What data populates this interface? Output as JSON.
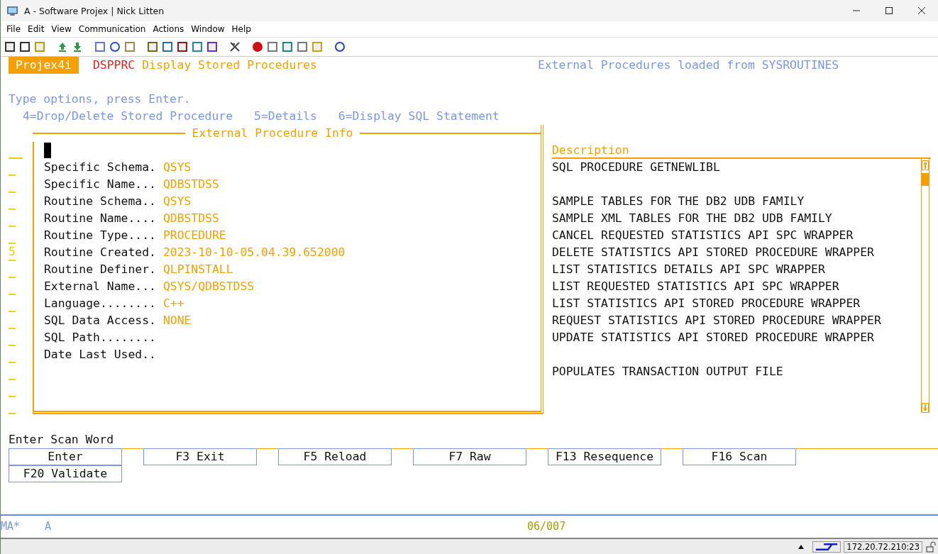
{
  "window": {
    "title": "A - Software Projex | Nick Litten"
  },
  "menu": [
    {
      "label": "File"
    },
    {
      "label": "Edit"
    },
    {
      "label": "View"
    },
    {
      "label": "Communication"
    },
    {
      "label": "Actions"
    },
    {
      "label": "Window"
    },
    {
      "label": "Help"
    }
  ],
  "header": {
    "product": "Projex4i",
    "command": "DSPPRC",
    "title": "Display Stored Procedures",
    "info": "External Procedures loaded from SYSROUTINES"
  },
  "instructions": "Type options, press Enter.",
  "options": [
    "4=Drop/Delete Stored Procedure",
    "5=Details",
    "6=Display SQL Statement"
  ],
  "option_fields": [
    {
      "kind": "position"
    },
    {
      "kind": "option"
    },
    {
      "kind": "option"
    },
    {
      "kind": "option"
    },
    {
      "kind": "option"
    },
    {
      "kind": "option"
    },
    {
      "kind": "option",
      "value": "5"
    },
    {
      "kind": "option"
    },
    {
      "kind": "option"
    },
    {
      "kind": "option"
    },
    {
      "kind": "option"
    },
    {
      "kind": "option"
    },
    {
      "kind": "option"
    },
    {
      "kind": "option"
    },
    {
      "kind": "option"
    },
    {
      "kind": "option"
    }
  ],
  "popup": {
    "title": "External Procedure Info",
    "fields": [
      {
        "label": "Specific Schema.",
        "value": "QSYS"
      },
      {
        "label": "Specific Name...",
        "value": "QDBSTDSS"
      },
      {
        "label": "Routine Schema..",
        "value": "QSYS"
      },
      {
        "label": "Routine Name....",
        "value": "QDBSTDSS"
      },
      {
        "label": "Routine Type....",
        "value": "PROCEDURE"
      },
      {
        "label": "Routine Created.",
        "value": "2023-10-10-05.04.39.652000"
      },
      {
        "label": "Routine Definer.",
        "value": "QLPINSTALL"
      },
      {
        "label": "External Name...",
        "value": "QSYS/QDBSTDSS"
      },
      {
        "label": "Language........",
        "value": "C++"
      },
      {
        "label": "SQL Data Access.",
        "value": "NONE"
      },
      {
        "label": "SQL Path........"
      },
      {
        "label": "Date Last Used.."
      }
    ]
  },
  "list": {
    "heading": "Description",
    "rows": [
      {
        "kind": "text",
        "description": "SQL PROCEDURE GETNEWLIBL"
      },
      {
        "kind": "blank"
      },
      {
        "kind": "text",
        "description": "SAMPLE TABLES FOR THE DB2 UDB FAMILY"
      },
      {
        "kind": "text",
        "description": "SAMPLE XML TABLES FOR THE DB2 UDB FAMILY"
      },
      {
        "kind": "text",
        "description": "CANCEL REQUESTED STATISTICS API SPC WRAPPER"
      },
      {
        "kind": "text",
        "description": "DELETE STATISTICS API STORED PROCEDURE WRAPPER"
      },
      {
        "kind": "text",
        "description": "LIST STATISTICS DETAILS API SPC WRAPPER"
      },
      {
        "kind": "text",
        "description": "LIST REQUESTED STATISTICS API SPC WRAPPER"
      },
      {
        "kind": "text",
        "description": "LIST STATISTICS API STORED PROCEDURE WRAPPER"
      },
      {
        "kind": "text",
        "description": "REQUEST STATISTICS API STORED PROCEDURE WRAPPER"
      },
      {
        "kind": "text",
        "description": "UPDATE STATISTICS API STORED PROCEDURE WRAPPER"
      },
      {
        "kind": "blank"
      },
      {
        "kind": "text",
        "description": "POPULATES TRANSACTION OUTPUT FILE"
      }
    ]
  },
  "scan_prompt": "Enter Scan Word",
  "function_keys": [
    {
      "label": "Enter"
    },
    {
      "label": "F3 Exit"
    },
    {
      "label": "F5 Reload"
    },
    {
      "label": "F7 Raw"
    },
    {
      "label": "F13 Resequence"
    },
    {
      "label": "F16 Scan"
    },
    {
      "label": "F20 Validate"
    }
  ],
  "operator_line": {
    "mode": "MA*",
    "session": "A",
    "cursor": "06/007"
  },
  "status_bar": {
    "host": "172.20.72.210:23"
  }
}
